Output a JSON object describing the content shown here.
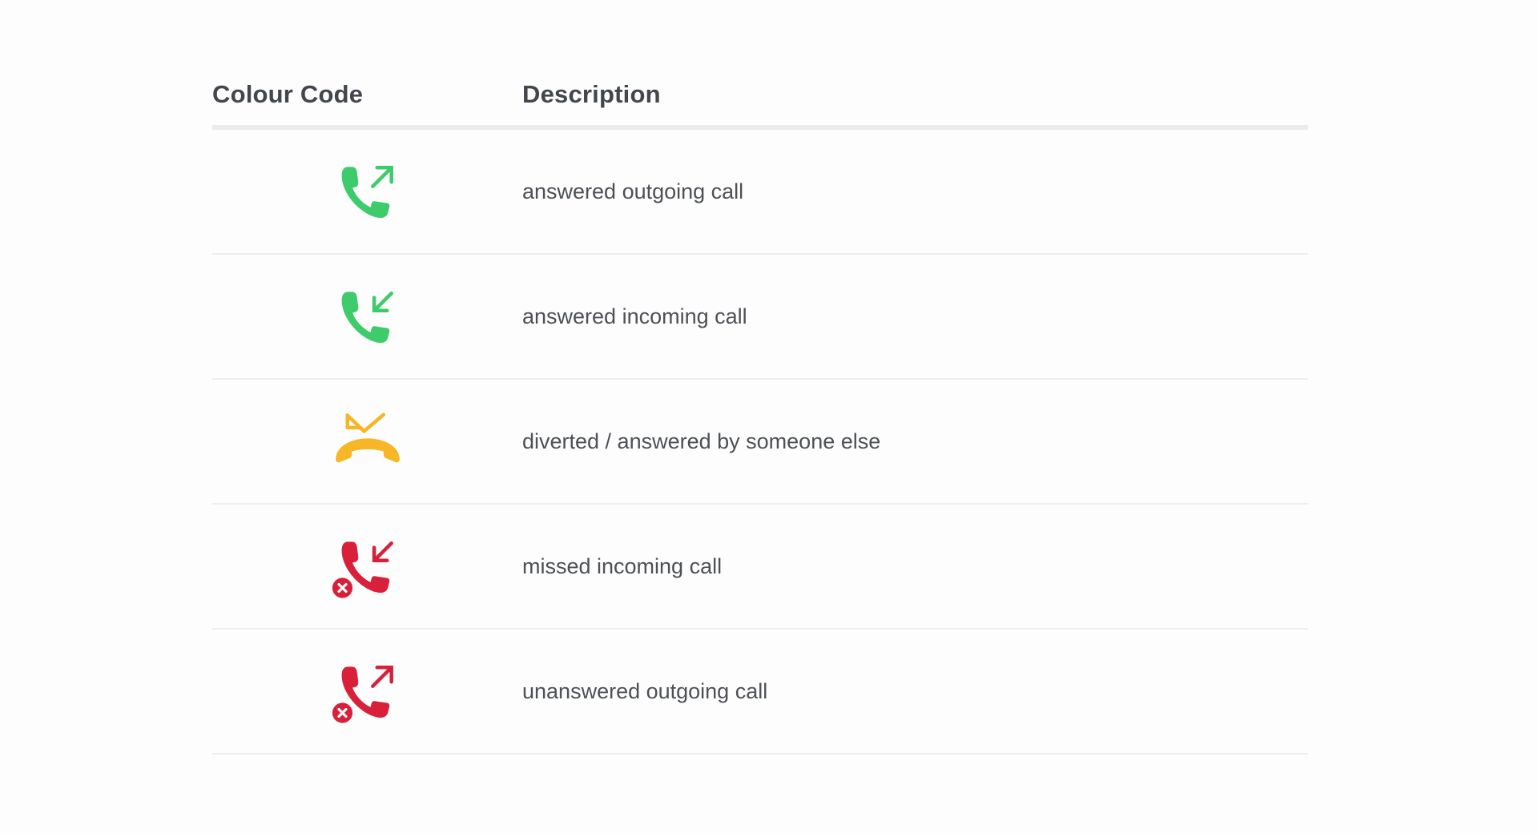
{
  "table": {
    "headers": {
      "code": "Colour Code",
      "description": "Description"
    },
    "rows": [
      {
        "icon": "phone-outgoing-icon",
        "color": "#3ecb6b",
        "description": "answered outgoing call"
      },
      {
        "icon": "phone-incoming-icon",
        "color": "#3ecb6b",
        "description": "answered incoming call"
      },
      {
        "icon": "phone-diverted-icon",
        "color": "#f7b625",
        "description": "diverted / answered by someone else"
      },
      {
        "icon": "phone-missed-incoming-icon",
        "color": "#d8203a",
        "description": "missed incoming call"
      },
      {
        "icon": "phone-unanswered-outgoing-icon",
        "color": "#d8203a",
        "description": "unanswered outgoing call"
      }
    ]
  }
}
